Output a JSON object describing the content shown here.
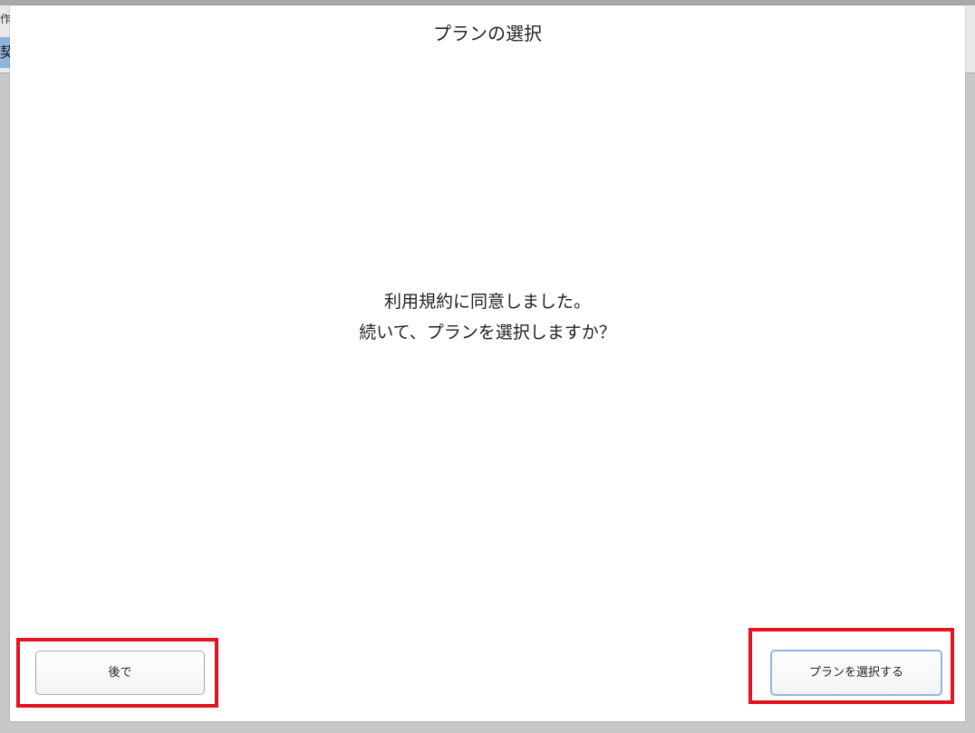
{
  "background": {
    "fragment_top": "作",
    "fragment_tab": "契約"
  },
  "dialog": {
    "title": "プランの選択",
    "message_line1": "利用規約に同意しました。",
    "message_line2": "続いて、プランを選択しますか？",
    "later_button": "後で",
    "select_button": "プランを選択する"
  },
  "colors": {
    "highlight_border": "#e3141f",
    "focused_button_border": "#8db6dd",
    "dialog_background": "#ffffff",
    "backdrop": "#c8c8c8"
  }
}
